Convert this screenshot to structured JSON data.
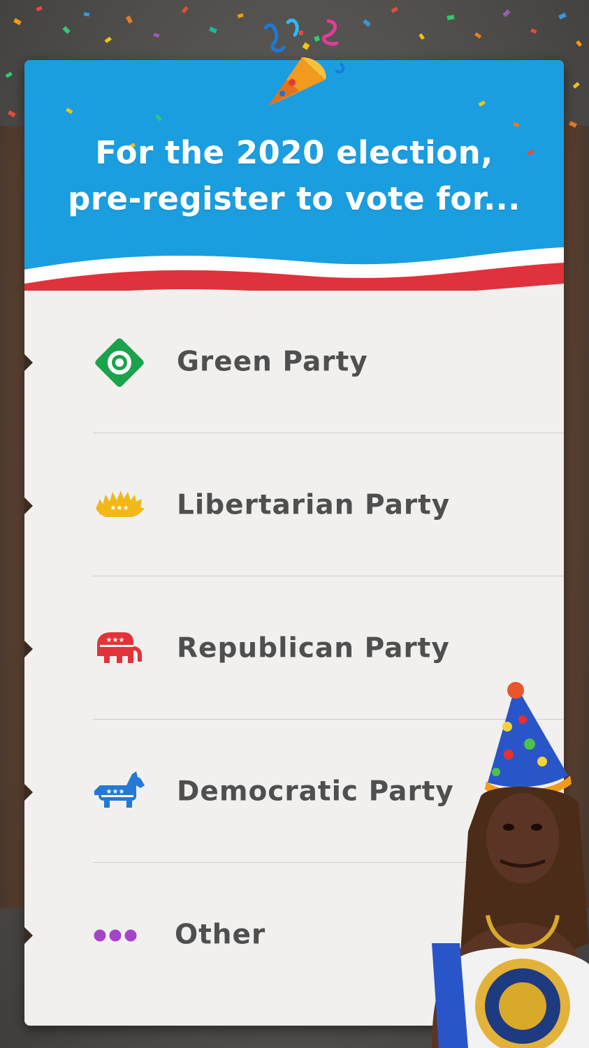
{
  "prompt": {
    "line1": "For the 2020 election,",
    "line2": "pre-register to vote for..."
  },
  "options": [
    {
      "label": "Green Party",
      "icon": "green-party-icon",
      "color": "#1aa34a"
    },
    {
      "label": "Libertarian Party",
      "icon": "porcupine-icon",
      "color": "#f2b818"
    },
    {
      "label": "Republican Party",
      "icon": "elephant-icon",
      "color": "#e23338"
    },
    {
      "label": "Democratic Party",
      "icon": "donkey-icon",
      "color": "#2478d6"
    },
    {
      "label": "Other",
      "icon": "three-dots-icon",
      "color": "#a544c8"
    }
  ],
  "theme": {
    "header_blue": "#1a9ee0",
    "stripe_red": "#e0323c",
    "text_gray": "#4f4f4f"
  },
  "decorations": [
    "party-popper-icon",
    "confetti",
    "party-hat-person-image"
  ]
}
